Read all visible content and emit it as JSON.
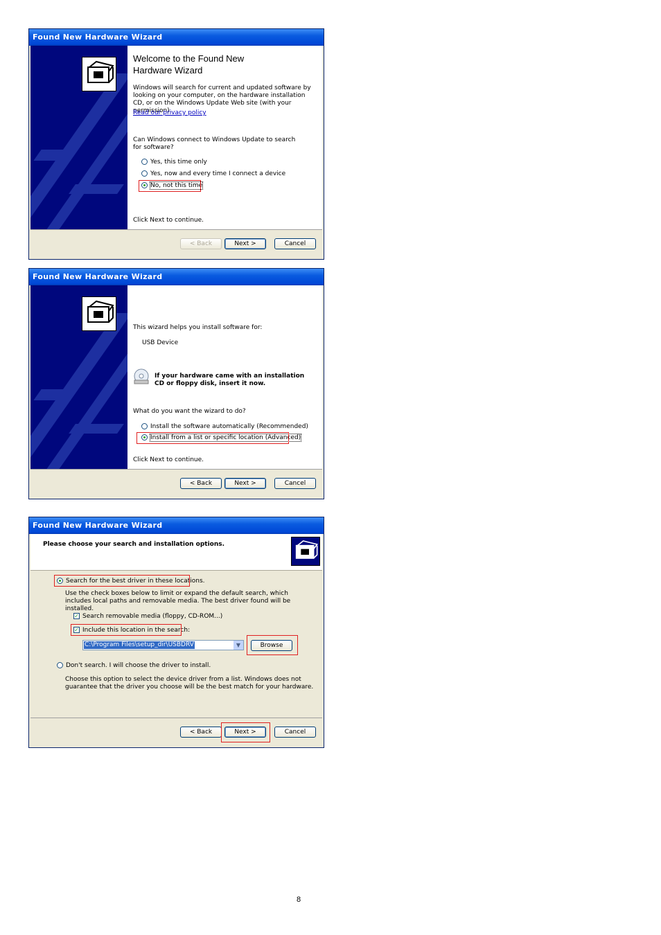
{
  "dialog1": {
    "title": "Found New Hardware Wizard",
    "heading": "Welcome to the Found New Hardware Wizard",
    "intro": "Windows will search for current and updated software by looking on your computer, on the hardware installation CD, or on the Windows Update Web site (with your permission).",
    "privacy_link": "Read our privacy policy",
    "question": "Can Windows connect to Windows Update to search for software?",
    "options": [
      "Yes, this time only",
      "Yes, now and every time I connect a device",
      "No, not this time"
    ],
    "selected_option": "No, not this time",
    "continue_text": "Click Next to continue.",
    "back_label": "< Back",
    "next_label": "Next >",
    "cancel_label": "Cancel"
  },
  "dialog2": {
    "title": "Found New Hardware Wizard",
    "helps_text": "This wizard helps you install software for:",
    "device_name": "USB Device",
    "cd_text": "If your hardware came with an installation CD or floppy disk, insert it now.",
    "question": "What do you want the wizard to do?",
    "options": [
      "Install the software automatically (Recommended)",
      "Install from a list or specific location (Advanced)"
    ],
    "selected_option": "Install from a list or specific location (Advanced)",
    "continue_text": "Click Next to continue.",
    "back_label": "< Back",
    "next_label": "Next >",
    "cancel_label": "Cancel"
  },
  "dialog3": {
    "title": "Found New Hardware Wizard",
    "header_text": "Please choose your search and installation options.",
    "search_option": "Search for the best driver in these locations.",
    "search_desc": "Use the check boxes below to limit or expand the default search, which includes local paths and removable media. The best driver found will be installed.",
    "check_removable": "Search removable media (floppy, CD-ROM...)",
    "check_location": "Include this location in the search:",
    "location_value": "C:\\Program Files\\setup_dir\\USBDRV",
    "browse_label": "Browse",
    "dont_search_option": "Don't search. I will choose the driver to install.",
    "dont_search_desc": "Choose this option to select the device driver from a list. Windows does not guarantee that the driver you choose will be the best match for your hardware.",
    "back_label": "< Back",
    "next_label": "Next >",
    "cancel_label": "Cancel"
  },
  "page_number": "8"
}
